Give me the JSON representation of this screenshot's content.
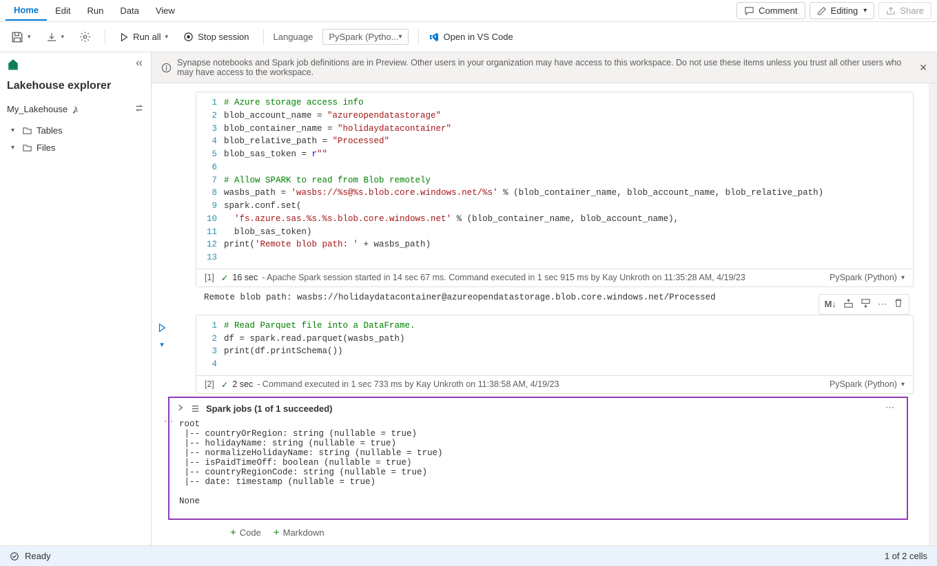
{
  "menu": {
    "items": [
      "Home",
      "Edit",
      "Run",
      "Data",
      "View"
    ],
    "active": 0,
    "comment": "Comment",
    "editing": "Editing",
    "share": "Share"
  },
  "toolbar": {
    "run_all": "Run all",
    "stop_session": "Stop session",
    "language_label": "Language",
    "language_value": "PySpark (Pytho...",
    "open_vscode": "Open in VS Code"
  },
  "left": {
    "title": "Lakehouse explorer",
    "lakehouse_name": "My_Lakehouse",
    "tree": {
      "tables": "Tables",
      "files": "Files"
    }
  },
  "banner": {
    "text": "Synapse notebooks and Spark job definitions are in Preview. Other users in your organization may have access to this workspace. Do not use these items unless you trust all other users who may have access to the workspace."
  },
  "cells": [
    {
      "exec_label": "[1]",
      "line_count": 13,
      "code_html": "<span class=\"c-comment\"># Azure storage access info</span>\nblob_account_name = <span class=\"c-str\">\"azureopendatastorage\"</span>\nblob_container_name = <span class=\"c-str\">\"holidaydatacontainer\"</span>\nblob_relative_path = <span class=\"c-str\">\"Processed\"</span>\nblob_sas_token = <span class=\"c-kw\">r</span><span class=\"c-str\">\"\"</span>\n\n<span class=\"c-comment\"># Allow SPARK to read from Blob remotely</span>\nwasbs_path = <span class=\"c-str\">'wasbs://%s@%s.blob.core.windows.net/%s'</span> % (blob_container_name, blob_account_name, blob_relative_path)\nspark.conf.set(\n  <span class=\"c-str\">'fs.azure.sas.%s.%s.blob.core.windows.net'</span> % (blob_container_name, blob_account_name),\n  blob_sas_token)\nprint(<span class=\"c-str\">'Remote blob path: '</span> + wasbs_path)\n",
      "status_time": "16 sec",
      "status_text": "- Apache Spark session started in 14 sec 67 ms. Command executed in 1 sec 915 ms by Kay Unkroth on 11:35:28 AM, 4/19/23",
      "kernel": "PySpark (Python)",
      "output": "Remote blob path: wasbs://holidaydatacontainer@azureopendatastorage.blob.core.windows.net/Processed"
    },
    {
      "exec_label": "[2]",
      "line_count": 4,
      "code_html": "<span class=\"c-comment\"># Read Parquet file into a DataFrame.</span>\ndf = spark.read.parquet(wasbs_path)\nprint(df.printSchema())\n",
      "status_time": "2 sec",
      "status_text": "- Command executed in 1 sec 733 ms by Kay Unkroth on 11:38:58 AM, 4/19/23",
      "kernel": "PySpark (Python)",
      "spark_jobs_title": "Spark jobs (1 of 1 succeeded)",
      "schema_output": "root\n |-- countryOrRegion: string (nullable = true)\n |-- holidayName: string (nullable = true)\n |-- normalizeHolidayName: string (nullable = true)\n |-- isPaidTimeOff: boolean (nullable = true)\n |-- countryRegionCode: string (nullable = true)\n |-- date: timestamp (nullable = true)\n\nNone"
    }
  ],
  "add": {
    "code": "Code",
    "markdown": "Markdown"
  },
  "status": {
    "ready": "Ready",
    "cells": "1 of 2 cells"
  },
  "icons": {
    "comment": "💬",
    "edit": "✎",
    "share": "↗",
    "play": "▶",
    "stop": "◉"
  }
}
